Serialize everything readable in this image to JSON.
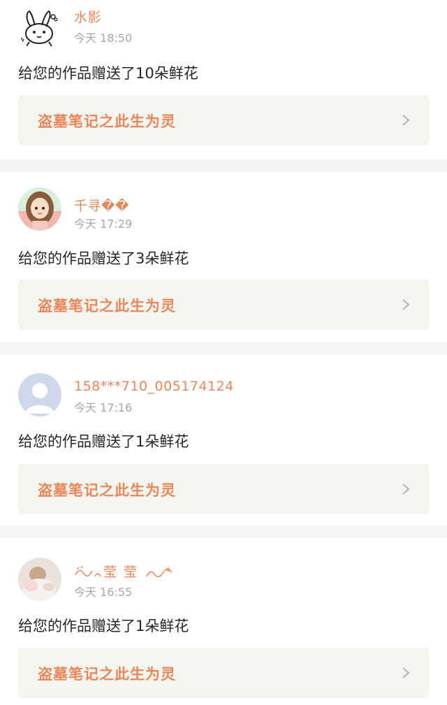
{
  "accent_color": "#e9865a",
  "items": [
    {
      "avatar": "bunny-doodle-avatar",
      "username": "水影",
      "time": "今天 18:50",
      "message": "给您的作品赠送了10朵鲜花",
      "work_title": "盗墓笔记之此生为灵"
    },
    {
      "avatar": "anime-girl-avatar",
      "username": "千寻��",
      "time": "今天 17:29",
      "message": "给您的作品赠送了3朵鲜花",
      "work_title": "盗墓笔记之此生为灵"
    },
    {
      "avatar": "default-user-avatar",
      "username": "158***710_005174124",
      "time": "今天 17:16",
      "message": "给您的作品赠送了1朵鲜花",
      "work_title": "盗墓笔记之此生为灵"
    },
    {
      "avatar": "photo-avatar",
      "username": "莹莹",
      "time": "今天 16:55",
      "message": "给您的作品赠送了1朵鲜花",
      "work_title": "盗墓笔记之此生为灵"
    }
  ]
}
